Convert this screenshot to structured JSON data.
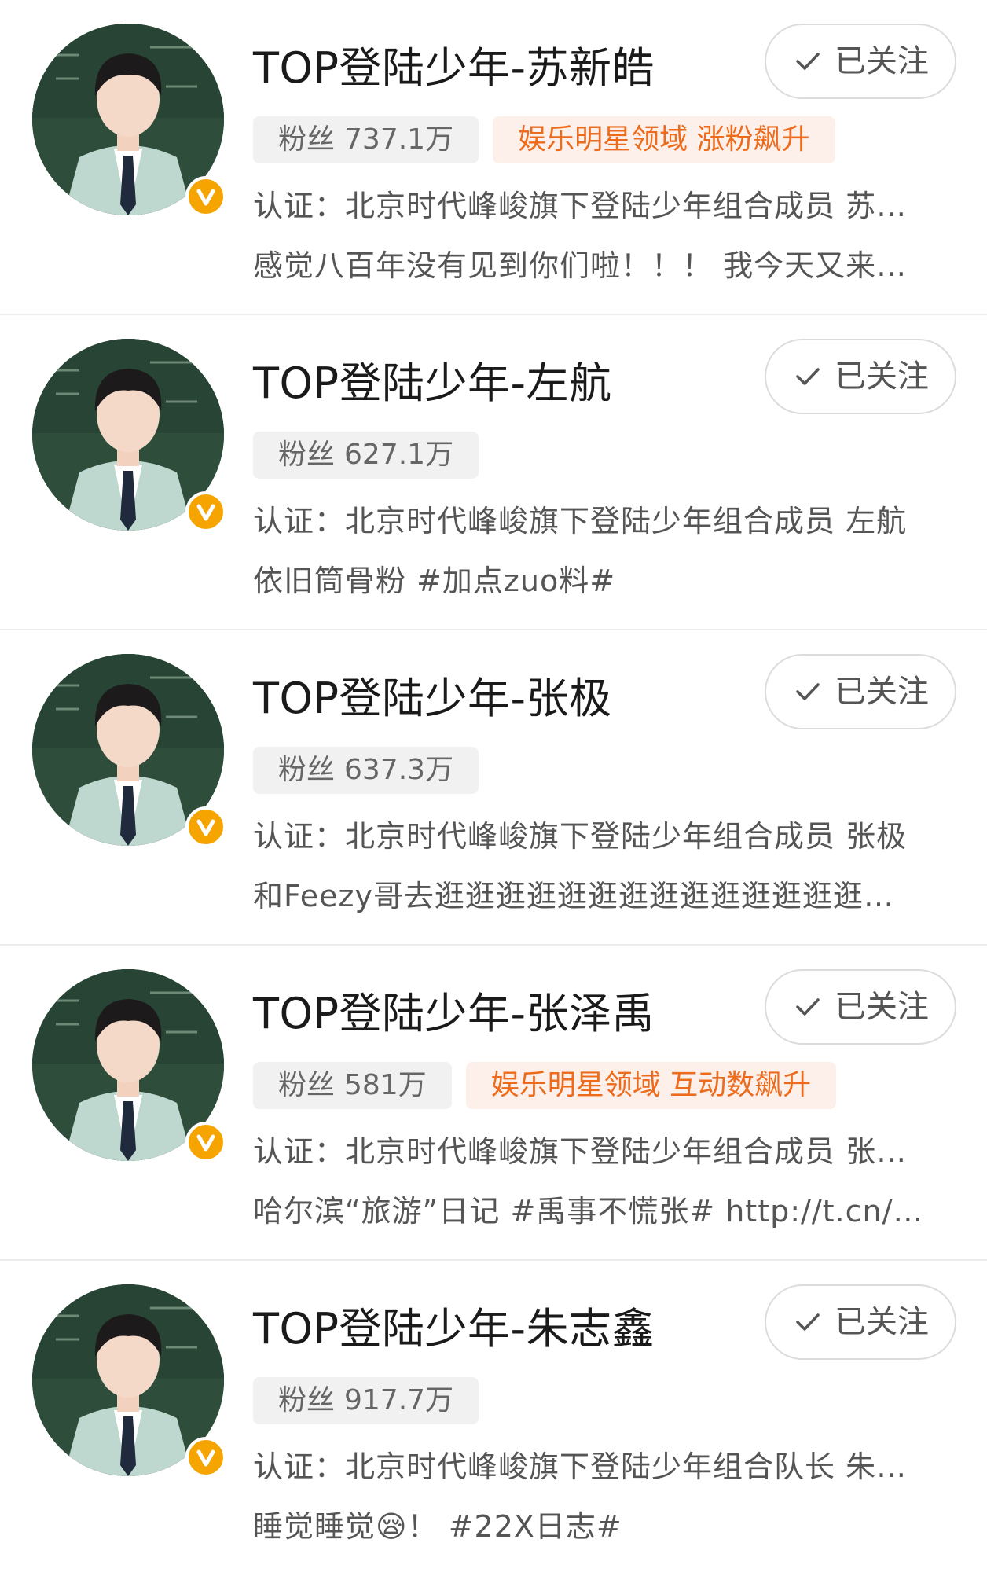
{
  "accounts": [
    {
      "name": "TOP登陆少年-苏新皓",
      "fans_label": "粉丝",
      "fans_value": "737.1万",
      "hot_tag": "娱乐明星领域 涨粉飙升",
      "verify": "认证：北京时代峰峻旗下登陆少年组合成员 苏…",
      "desc": "感觉八百年没有见到你们啦！！！ 我今天又来…",
      "follow_label": "已关注"
    },
    {
      "name": "TOP登陆少年-左航",
      "fans_label": "粉丝",
      "fans_value": "627.1万",
      "hot_tag": "",
      "verify": "认证：北京时代峰峻旗下登陆少年组合成员 左航",
      "desc": "依旧筒骨粉 #加点zuo料#",
      "follow_label": "已关注"
    },
    {
      "name": "TOP登陆少年-张极",
      "fans_label": "粉丝",
      "fans_value": "637.3万",
      "hot_tag": "",
      "verify": "认证：北京时代峰峻旗下登陆少年组合成员 张极",
      "desc": "和Feezy哥去逛逛逛逛逛逛逛逛逛逛逛逛逛逛…",
      "follow_label": "已关注"
    },
    {
      "name": "TOP登陆少年-张泽禹",
      "fans_label": "粉丝",
      "fans_value": "581万",
      "hot_tag": "娱乐明星领域 互动数飙升",
      "verify": "认证：北京时代峰峻旗下登陆少年组合成员 张…",
      "desc": "哈尔滨“旅游”日记 #禹事不慌张# http://t.cn/…",
      "follow_label": "已关注"
    },
    {
      "name": "TOP登陆少年-朱志鑫",
      "fans_label": "粉丝",
      "fans_value": "917.7万",
      "hot_tag": "",
      "verify": "认证：北京时代峰峻旗下登陆少年组合队长 朱…",
      "desc": "睡觉睡觉😪！ #22X日志#",
      "follow_label": "已关注"
    }
  ],
  "icons": {
    "verified": "verified-v-badge-icon",
    "follow_check": "checkmark-icon"
  },
  "colors": {
    "hot_tag_text": "#ec6b1c",
    "hot_tag_bg": "#fdf0ea",
    "verified_badge": "#f5a400",
    "divider": "#ececec"
  }
}
